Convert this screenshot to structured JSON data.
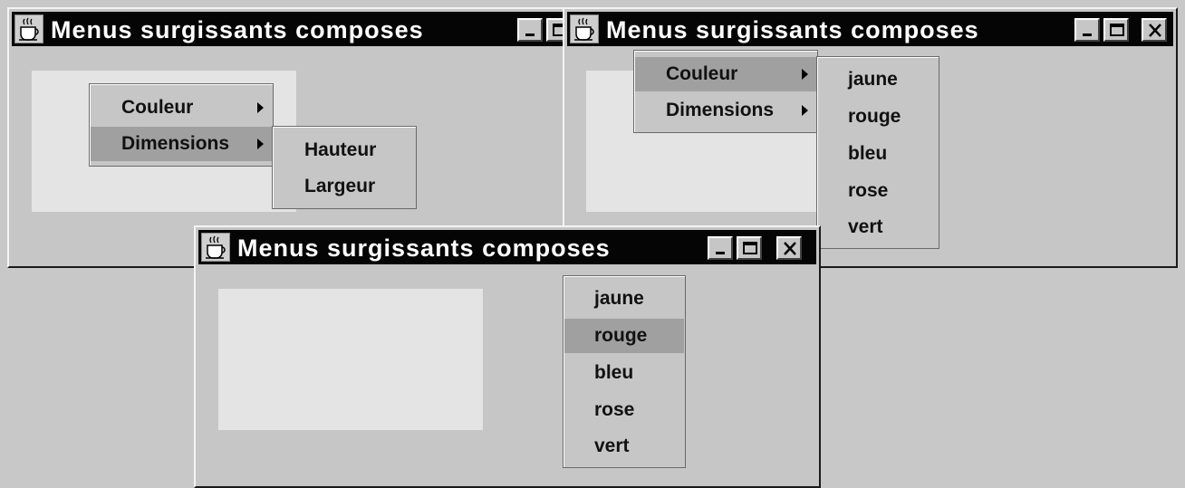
{
  "window_title": "Menus surgissants composes",
  "title_icon": "java-coffee-cup-icon",
  "title_buttons": {
    "minimize_icon": "minimize-icon",
    "maximize_icon": "maximize-icon",
    "close_icon": "close-icon"
  },
  "main_menu": {
    "items": [
      {
        "label": "Couleur",
        "has_submenu": true
      },
      {
        "label": "Dimensions",
        "has_submenu": true
      }
    ]
  },
  "window1": {
    "selected_item": "Dimensions",
    "submenu": [
      "Hauteur",
      "Largeur"
    ]
  },
  "window2": {
    "selected_item": "Couleur",
    "submenu": [
      "jaune",
      "rouge",
      "bleu",
      "rose",
      "vert"
    ]
  },
  "window3": {
    "color_menu": [
      "jaune",
      "rouge",
      "bleu",
      "rose",
      "vert"
    ],
    "selected_color": "rouge"
  },
  "colors": {
    "title_bar": "#050505",
    "window_bg": "#c6c6c6",
    "panel_bg": "#e4e4e4",
    "selection_bg": "#a0a0a0"
  }
}
